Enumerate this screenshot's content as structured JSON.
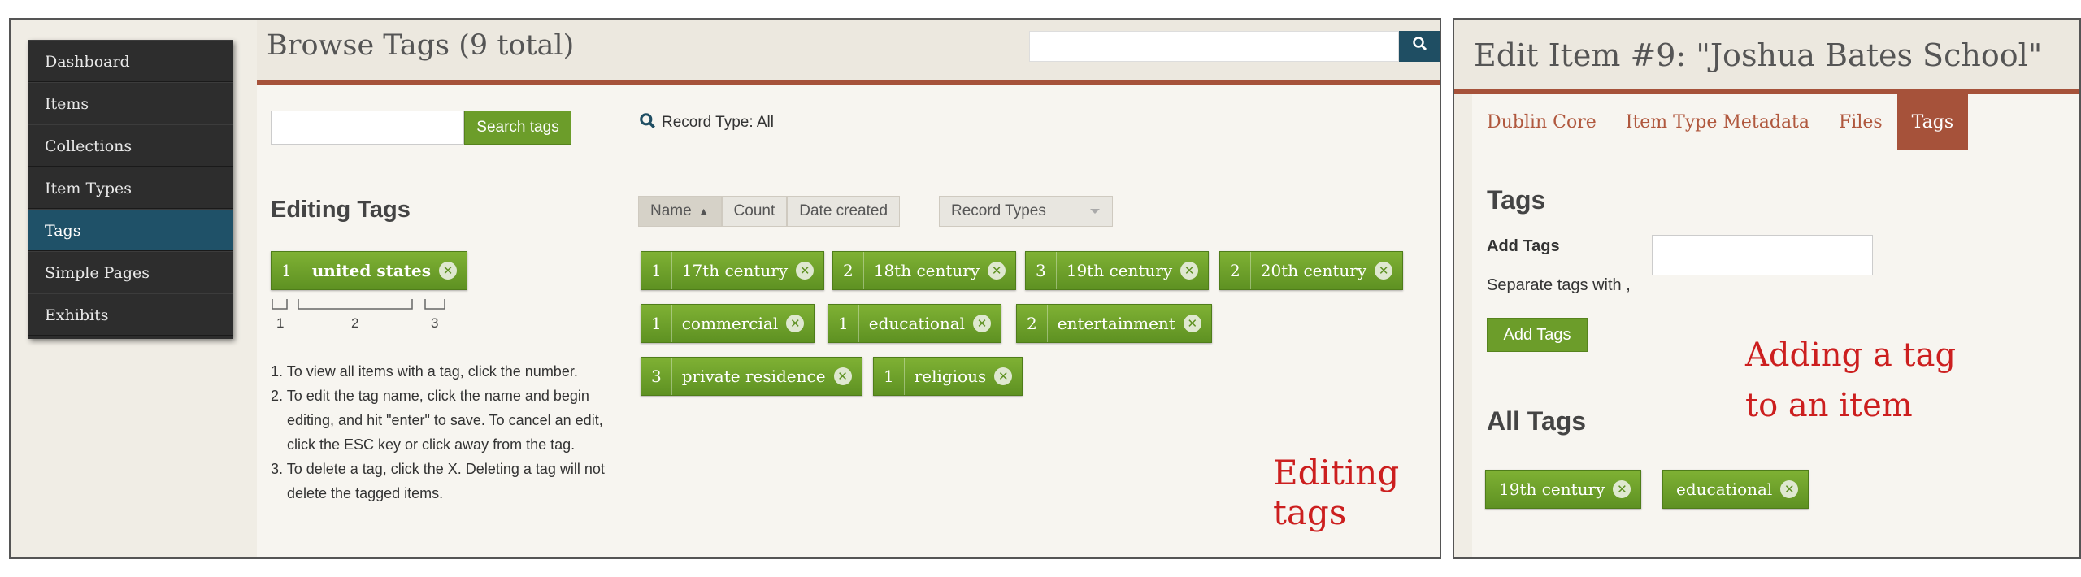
{
  "left": {
    "nav": [
      {
        "label": "Dashboard",
        "active": false
      },
      {
        "label": "Items",
        "active": false
      },
      {
        "label": "Collections",
        "active": false
      },
      {
        "label": "Item Types",
        "active": false
      },
      {
        "label": "Tags",
        "active": true
      },
      {
        "label": "Simple Pages",
        "active": false
      },
      {
        "label": "Exhibits",
        "active": false
      }
    ],
    "title": "Browse Tags (9 total)",
    "search_button_icon": "search-icon",
    "tag_search_button": "Search tags",
    "record_type_filter": "Record Type: All",
    "editing_heading": "Editing Tags",
    "sample_tag": {
      "count": "1",
      "name": "united states"
    },
    "diagram_labels": [
      "1",
      "2",
      "3"
    ],
    "instructions": [
      "1. To view all items with a tag, click the number.",
      "2. To edit the tag name, click the name and begin editing, and hit \"enter\" to save. To cancel an edit, click the ESC key or click away from the tag.",
      "3. To delete a tag, click the X. Deleting a tag will not delete the tagged items."
    ],
    "sort": {
      "name": "Name",
      "name_arrow": "▲",
      "count": "Count",
      "date_created": "Date created"
    },
    "record_types_select": "Record Types",
    "tags": [
      {
        "count": "1",
        "name": "17th century"
      },
      {
        "count": "2",
        "name": "18th century"
      },
      {
        "count": "3",
        "name": "19th century"
      },
      {
        "count": "2",
        "name": "20th century"
      },
      {
        "count": "1",
        "name": "commercial"
      },
      {
        "count": "1",
        "name": "educational"
      },
      {
        "count": "2",
        "name": "entertainment"
      },
      {
        "count": "3",
        "name": "private residence"
      },
      {
        "count": "1",
        "name": "religious"
      }
    ],
    "caption": "Editing tags"
  },
  "right": {
    "title": "Edit Item #9: \"Joshua Bates School\"",
    "tabs": [
      {
        "label": "Dublin Core",
        "active": false
      },
      {
        "label": "Item Type Metadata",
        "active": false
      },
      {
        "label": "Files",
        "active": false
      },
      {
        "label": "Tags",
        "active": true
      }
    ],
    "tags_heading": "Tags",
    "add_tags_label": "Add Tags",
    "separator_hint": "Separate tags with ,",
    "add_tags_button": "Add Tags",
    "all_tags_heading": "All Tags",
    "item_tags": [
      "19th century",
      "educational"
    ],
    "caption_line1": "Adding a tag",
    "caption_line2": "to an item"
  },
  "colors": {
    "accent": "#a6523a",
    "tag_green": "#6c9d2a",
    "nav_active": "#1f5168",
    "caption_red": "#cc1f1f"
  }
}
